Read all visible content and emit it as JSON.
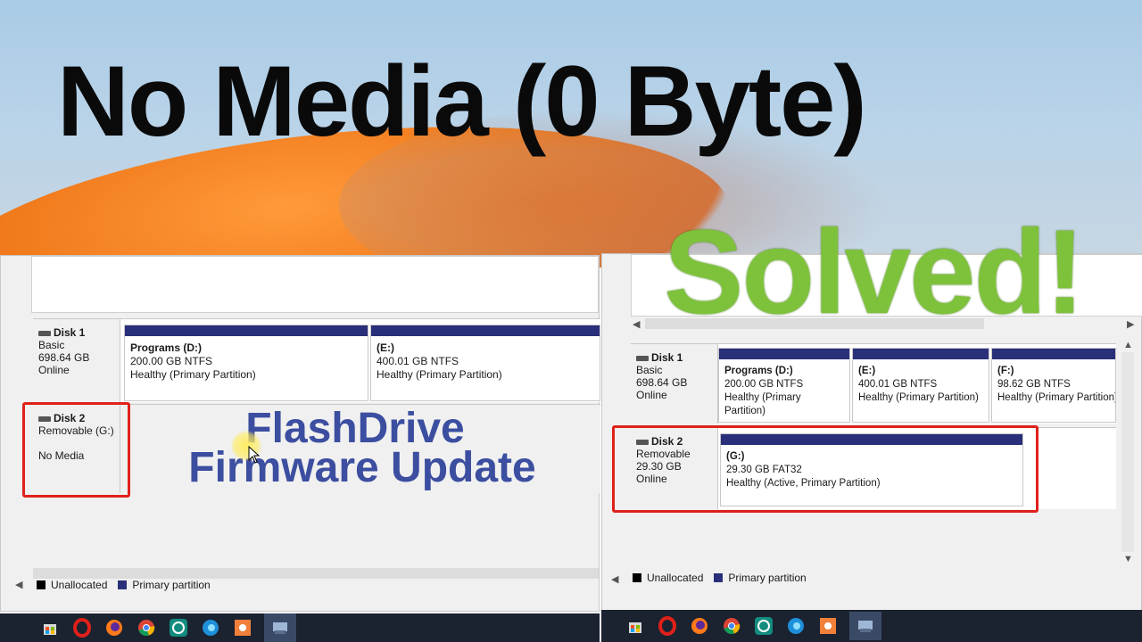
{
  "headline": "No Media (0 Byte)",
  "solved_text": "Solved!",
  "overlay": {
    "line1": "FlashDrive",
    "line2": "Firmware Update"
  },
  "left_panel": {
    "disk1": {
      "name": "Disk 1",
      "type": "Basic",
      "size": "698.64 GB",
      "status": "Online",
      "partitions": [
        {
          "name": "Programs  (D:)",
          "size": "200.00 GB NTFS",
          "health": "Healthy (Primary Partition)"
        },
        {
          "name": "(E:)",
          "size": "400.01 GB NTFS",
          "health": "Healthy (Primary Partition)"
        }
      ]
    },
    "disk2": {
      "name": "Disk 2",
      "type": "Removable (G:)",
      "status": "No Media"
    },
    "legend": {
      "unallocated": "Unallocated",
      "primary": "Primary partition"
    }
  },
  "right_panel": {
    "disk1": {
      "name": "Disk 1",
      "type": "Basic",
      "size": "698.64 GB",
      "status": "Online",
      "partitions": [
        {
          "name": "Programs  (D:)",
          "size": "200.00 GB NTFS",
          "health": "Healthy (Primary Partition)"
        },
        {
          "name": "(E:)",
          "size": "400.01 GB NTFS",
          "health": "Healthy (Primary Partition)"
        },
        {
          "name": "(F:)",
          "size": "98.62 GB NTFS",
          "health": "Healthy (Primary Partition)"
        }
      ]
    },
    "disk2": {
      "name": "Disk 2",
      "type": "Removable",
      "size": "29.30 GB",
      "status": "Online",
      "partition": {
        "name": "(G:)",
        "size": "29.30 GB FAT32",
        "health": "Healthy (Active, Primary Partition)"
      }
    },
    "legend": {
      "unallocated": "Unallocated",
      "primary": "Primary partition"
    }
  },
  "colors": {
    "partition_bar": "#2a2f7a",
    "highlight_box": "#e0201a",
    "solved_green": "#7ec23c",
    "overlay_blue": "#3c4ea0"
  },
  "taskbar_icons": [
    "store-icon",
    "opera-icon",
    "firefox-icon",
    "chrome-icon",
    "whatsapp-icon",
    "edge-icon",
    "app-icon",
    "disk-management-icon"
  ]
}
